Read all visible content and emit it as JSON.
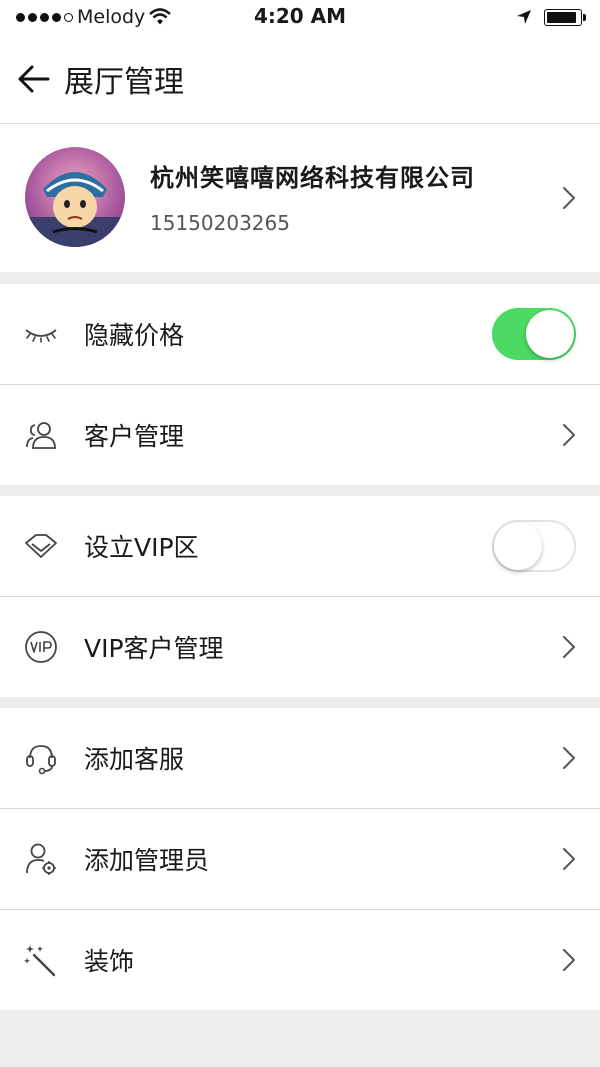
{
  "status_bar": {
    "carrier": "Melody",
    "time": "4:20 AM"
  },
  "header": {
    "title": "展厅管理"
  },
  "profile": {
    "company_name": "杭州笑嘻嘻网络科技有限公司",
    "phone": "15150203265"
  },
  "settings": {
    "hide_price": {
      "label": "隐藏价格",
      "icon": "eye-closed-icon",
      "enabled": true
    },
    "customer_mgmt": {
      "label": "客户管理",
      "icon": "users-icon"
    },
    "vip_zone": {
      "label": "设立VIP区",
      "icon": "diamond-icon",
      "enabled": false
    },
    "vip_customer_mgmt": {
      "label": "VIP客户管理",
      "icon": "vip-badge-icon"
    },
    "add_service": {
      "label": "添加客服",
      "icon": "headset-icon"
    },
    "add_admin": {
      "label": "添加管理员",
      "icon": "user-gear-icon"
    },
    "decoration": {
      "label": "装饰",
      "icon": "magic-wand-icon"
    }
  },
  "colors": {
    "toggle_on": "#4cd964",
    "background": "#ececec"
  }
}
